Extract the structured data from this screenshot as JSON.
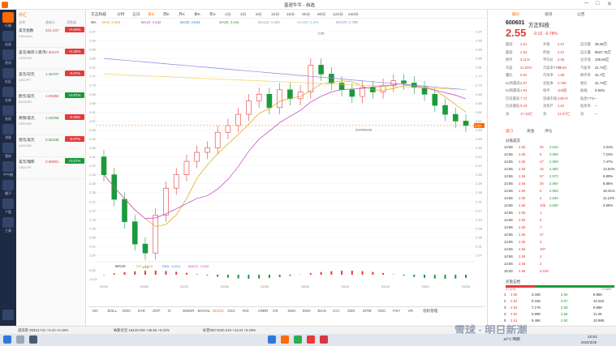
{
  "titlebar": {
    "app_title": "富途牛牛 - 自选",
    "menu_icons": [
      "minimize-icon",
      "maximize-icon",
      "close-icon"
    ]
  },
  "leftnav": {
    "items": [
      "行情",
      "自选",
      "资讯",
      "社区",
      "交易",
      "发现",
      "消息",
      "我的",
      "牛牛圈",
      "圈子",
      "个股",
      "工具",
      "更多"
    ]
  },
  "fx_panel": {
    "tabs": [
      "外汇"
    ],
    "columns": [
      "名称",
      "最新价",
      "涨跌幅"
    ],
    "rows": [
      {
        "name": "美元指数",
        "code": "USDindex",
        "price": "104.237",
        "chg": "+0.00%",
        "dir": "up"
      },
      {
        "name": "美元/离岸人民币",
        "code": "USDCNH",
        "price": "0.90274",
        "chg": "+0.36%",
        "dir": "up"
      },
      {
        "name": "美元/日元",
        "code": "USDJPY",
        "price": "1.35707",
        "chg": "-0.07%",
        "dir": "dn"
      },
      {
        "name": "欧元/美元",
        "code": "EURUSD",
        "price": "1.08382",
        "chg": "+0.07%",
        "dir": "up"
      },
      {
        "name": "英镑/美元",
        "code": "GBPUSD",
        "price": "1.26258",
        "chg": "-0.09%",
        "dir": "dn"
      },
      {
        "name": "澳元/美元",
        "code": "AUDUSD",
        "price": "0.65335",
        "chg": "-0.07%",
        "dir": "dn"
      },
      {
        "name": "美元/瑞郎",
        "code": "USDCHF",
        "price": "0.58981",
        "chg": "+0.27%",
        "dir": "up"
      }
    ]
  },
  "chart_header": {
    "stock_label": "方正科技",
    "timeframes": [
      "分时",
      "五日",
      "日K",
      "周K",
      "月K",
      "季K",
      "年K",
      "1分",
      "3分",
      "5分",
      "10分",
      "15分",
      "30分",
      "60分",
      "120分",
      "240分"
    ],
    "active_timeframe": "日K"
  },
  "ma_bar": {
    "items": [
      {
        "label": "MA",
        "color": "#333"
      },
      {
        "label": "MA5: 2.550",
        "color": "#e0a000"
      },
      {
        "label": "MA10: 2.642",
        "color": "#c040c0"
      },
      {
        "label": "MA20: 2.644",
        "color": "#2f7bd8"
      },
      {
        "label": "MA60: 2.646",
        "color": "#3aa04a"
      },
      {
        "label": "MA120: 2.598",
        "color": "#a0a0a0"
      },
      {
        "label": "MA250: 2.690",
        "color": "#6ad0d8"
      },
      {
        "label": "MA270: 2.789",
        "color": "#8888dd"
      }
    ]
  },
  "chart": {
    "y_ticks": [
      "2.97",
      "2.93",
      "2.89",
      "2.85",
      "2.81",
      "2.77",
      "2.73",
      "2.69",
      "2.65",
      "2.61",
      "2.57",
      "2.53",
      "2.49",
      "2.45",
      "2.41",
      "2.37",
      "2.33",
      "2.29",
      "2.25",
      "2.21",
      "2.17",
      "2.13",
      "2.09",
      "2.05",
      "2.01",
      "1.97"
    ],
    "x_ticks": [
      "02/05",
      "02/08",
      "02/21",
      "02/26",
      "02/29",
      "03/06",
      "03/13",
      "03/18",
      "03/21",
      "03/26"
    ],
    "high_label": "2.95",
    "low_label": "1.93",
    "last_price_tag": "2.55",
    "date_tag": "2024/03/26",
    "macd_label": "MACD",
    "macd_values": [
      "DIF: -0.025",
      "DEA: -0.024",
      "MACD: -0.002"
    ],
    "macd_ticks": [
      "0.00",
      "-0.13"
    ]
  },
  "chart_data": {
    "type": "candlestick",
    "x": [
      "01/29",
      "01/30",
      "01/31",
      "02/01",
      "02/02",
      "02/05",
      "02/06",
      "02/07",
      "02/08",
      "02/19",
      "02/20",
      "02/21",
      "02/22",
      "02/23",
      "02/26",
      "02/27",
      "02/28",
      "02/29",
      "03/01",
      "03/04",
      "03/05",
      "03/06",
      "03/07",
      "03/08",
      "03/11",
      "03/12",
      "03/13",
      "03/14",
      "03/15",
      "03/18",
      "03/19",
      "03/20",
      "03/21",
      "03/22",
      "03/25",
      "03/26"
    ],
    "close": [
      2.33,
      2.22,
      2.12,
      2.02,
      1.98,
      2.15,
      2.27,
      2.33,
      2.39,
      2.43,
      2.45,
      2.52,
      2.55,
      2.6,
      2.66,
      2.69,
      2.63,
      2.71,
      2.67,
      2.7,
      2.82,
      2.78,
      2.74,
      2.71,
      2.68,
      2.72,
      2.7,
      2.73,
      2.75,
      2.74,
      2.72,
      2.69,
      2.64,
      2.6,
      2.57,
      2.55
    ]
  },
  "indicators": [
    "MA",
    "BOLL",
    "EMA",
    "SAR",
    "ZGP",
    "IC",
    "WMSR",
    "MAVOL",
    "MACD",
    "KDJ",
    "RSI",
    "ARBR",
    "CR",
    "DMA",
    "EMV",
    "BIAS",
    "CCI",
    "DMI",
    "MTM",
    "OSC",
    "PSY",
    "VR",
    "指标管理"
  ],
  "active_indicator": "MACD",
  "quote": {
    "tabs": [
      "股价",
      "资讯",
      "公告"
    ],
    "code": "600601",
    "name": "方正科技",
    "price": "2.55",
    "change": "-0.02",
    "change_pct": "-0.78%",
    "stats_left": [
      [
        "最高",
        "2.61"
      ],
      [
        "最低",
        "2.53"
      ],
      [
        "换手",
        "3.11%"
      ],
      [
        "市盈",
        "21.80%"
      ],
      [
        "量比",
        "0.82"
      ],
      [
        "52周最高",
        "3.07"
      ],
      [
        "52周最低",
        "1.93"
      ],
      [
        "历史最高",
        "7.72"
      ],
      [
        "历史最低",
        "0.43"
      ],
      [
        "净",
        "17.15亿"
      ]
    ],
    "stats_mid": [
      [
        "开盘",
        "2.57"
      ],
      [
        "昨收",
        "2.57"
      ],
      [
        "平均价",
        "2.56"
      ],
      [
        "市盈率TTM",
        "79.69"
      ],
      [
        "市净率",
        "1.89"
      ],
      [
        "总股本",
        "2.796"
      ],
      [
        "每手",
        "100股"
      ],
      [
        "流通市值",
        "239.07"
      ],
      [
        "净资产",
        "2.81"
      ],
      [
        "净",
        "21.67亿"
      ]
    ],
    "stats_right": [
      [
        "成交额",
        "38.38万"
      ],
      [
        "成交量",
        "9537.75万"
      ],
      [
        "总市值",
        "106.84亿"
      ],
      [
        "市盈率",
        "41.74亿"
      ],
      [
        "换手率",
        "41.7亿"
      ],
      [
        "委比",
        "41.74亿"
      ],
      [
        "振幅",
        "0.92%"
      ],
      [
        "股息TTM",
        "--"
      ],
      [
        "股息率",
        "--"
      ],
      [
        "净",
        "--"
      ]
    ],
    "detail_tabs": [
      "盘口",
      "资金",
      "评论"
    ],
    "ticks_header": "分笔成交",
    "ticks": [
      [
        "14:55",
        "2.55",
        "25",
        "2.610",
        "1.01%"
      ],
      [
        "14:55",
        "2.55",
        "6",
        "2.600",
        "7.23%"
      ],
      [
        "14:55",
        "2.55",
        "47",
        "2.590",
        "7.47%"
      ],
      [
        "14:55",
        "2.55",
        "16",
        "2.580",
        "12.54%"
      ],
      [
        "14:55",
        "2.55",
        "67",
        "2.570",
        "9.89%"
      ],
      [
        "14:56",
        "2.55",
        "30",
        "2.560",
        "8.86%"
      ],
      [
        "14:56",
        "2.55",
        "6",
        "2.550",
        "15.31%"
      ],
      [
        "14:56",
        "2.55",
        "4",
        "2.540",
        "11.12%"
      ],
      [
        "14:56",
        "2.55",
        "105",
        "2.530",
        "3.55%"
      ],
      [
        "14:56",
        "2.55",
        "1",
        "",
        " "
      ],
      [
        "14:56",
        "2.55",
        "5",
        "",
        " "
      ],
      [
        "14:56",
        "2.55",
        "7",
        "",
        " "
      ],
      [
        "14:56",
        "2.55",
        "47",
        "",
        " "
      ],
      [
        "14:56",
        "2.55",
        "3",
        "",
        " "
      ],
      [
        "14:56",
        "2.55",
        "187",
        "",
        " "
      ],
      [
        "14:56",
        "2.55",
        "4",
        "",
        " "
      ],
      [
        "14:56",
        "2.55",
        "2",
        "",
        " "
      ],
      [
        "15:00",
        "2.55",
        "3.01K",
        "",
        " "
      ]
    ],
    "order_book_title": "买盘五档",
    "order_book_pct": [
      "27.02%",
      "72.08%"
    ],
    "order_book": [
      [
        "1",
        "2.55",
        "3.44K",
        "2.56",
        "8.86K"
      ],
      [
        "2",
        "2.54",
        "9.15K",
        "2.57",
        "10.01K"
      ],
      [
        "3",
        "2.53",
        "7.17K",
        "2.58",
        "9.58K"
      ],
      [
        "4",
        "2.52",
        "8.58K",
        "2.59",
        "11.2K"
      ],
      [
        "5",
        "2.51",
        "9.46K",
        "2.60",
        "10.88K"
      ]
    ]
  },
  "statusbar": {
    "items": [
      "道琼斯 39313.741 +0.10 +0.15%",
      "纳斯达克 16420.028 +35.55 +0.22%",
      "标普500 5220.219 +14.04 +0.19%"
    ],
    "watermark": "雪球 · 明日新潮"
  },
  "taskbar": {
    "time": "22:53",
    "date": "2024/3/26",
    "weather": "10°C 晴朗"
  }
}
